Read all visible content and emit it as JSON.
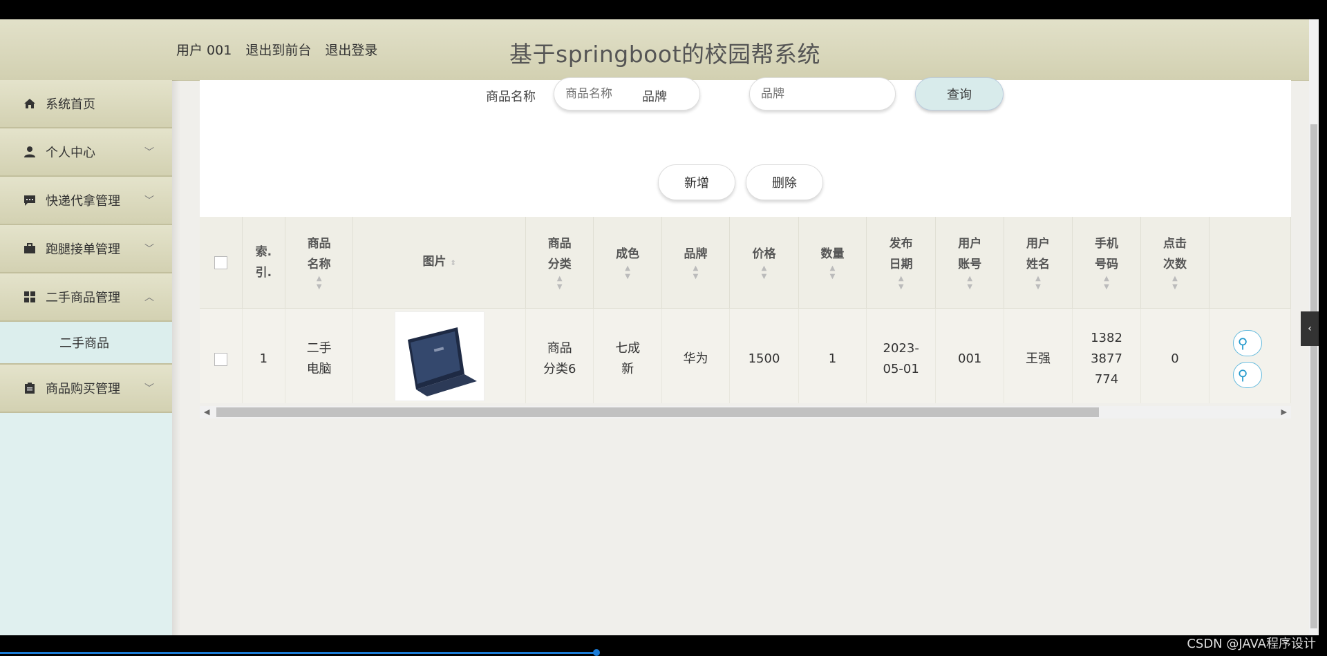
{
  "header": {
    "user": "用户 001",
    "to_front": "退出到前台",
    "logout": "退出登录",
    "title": "基于springboot的校园帮系统"
  },
  "sidebar": {
    "items": [
      {
        "label": "系统首页",
        "icon": "home-icon"
      },
      {
        "label": "个人中心",
        "icon": "user-icon"
      },
      {
        "label": "快递代拿管理",
        "icon": "message-icon"
      },
      {
        "label": "跑腿接单管理",
        "icon": "briefcase-icon"
      },
      {
        "label": "二手商品管理",
        "icon": "grid-icon"
      },
      {
        "label": "商品购买管理",
        "icon": "clipboard-icon"
      }
    ],
    "submenu": [
      "二手商品"
    ]
  },
  "search": {
    "name_label": "商品名称",
    "name_placeholder": "商品名称",
    "brand_label": "品牌",
    "brand_placeholder": "品牌",
    "query_button": "查询"
  },
  "actions": {
    "add": "新增",
    "delete": "删除"
  },
  "table": {
    "headers": {
      "index": [
        "索.",
        "引."
      ],
      "name": [
        "商品",
        "名称"
      ],
      "image": "图片",
      "category": [
        "商品",
        "分类"
      ],
      "condition": "成色",
      "brand": "品牌",
      "price": "价格",
      "quantity": "数量",
      "date": [
        "发布",
        "日期"
      ],
      "account": [
        "用户",
        "账号"
      ],
      "username": [
        "用户",
        "姓名"
      ],
      "phone": [
        "手机",
        "号码"
      ],
      "clicks": [
        "点击",
        "次数"
      ]
    },
    "rows": [
      {
        "index": "1",
        "name": [
          "二手",
          "电脑"
        ],
        "category": [
          "商品",
          "分类6"
        ],
        "condition": [
          "七成",
          "新"
        ],
        "brand": "华为",
        "price": "1500",
        "quantity": "1",
        "date": [
          "2023-",
          "05-01"
        ],
        "account": "001",
        "username": "王强",
        "phone": [
          "1382",
          "3877",
          "774"
        ],
        "clicks": "0"
      }
    ]
  },
  "watermark": "CSDN @JAVA程序设计"
}
